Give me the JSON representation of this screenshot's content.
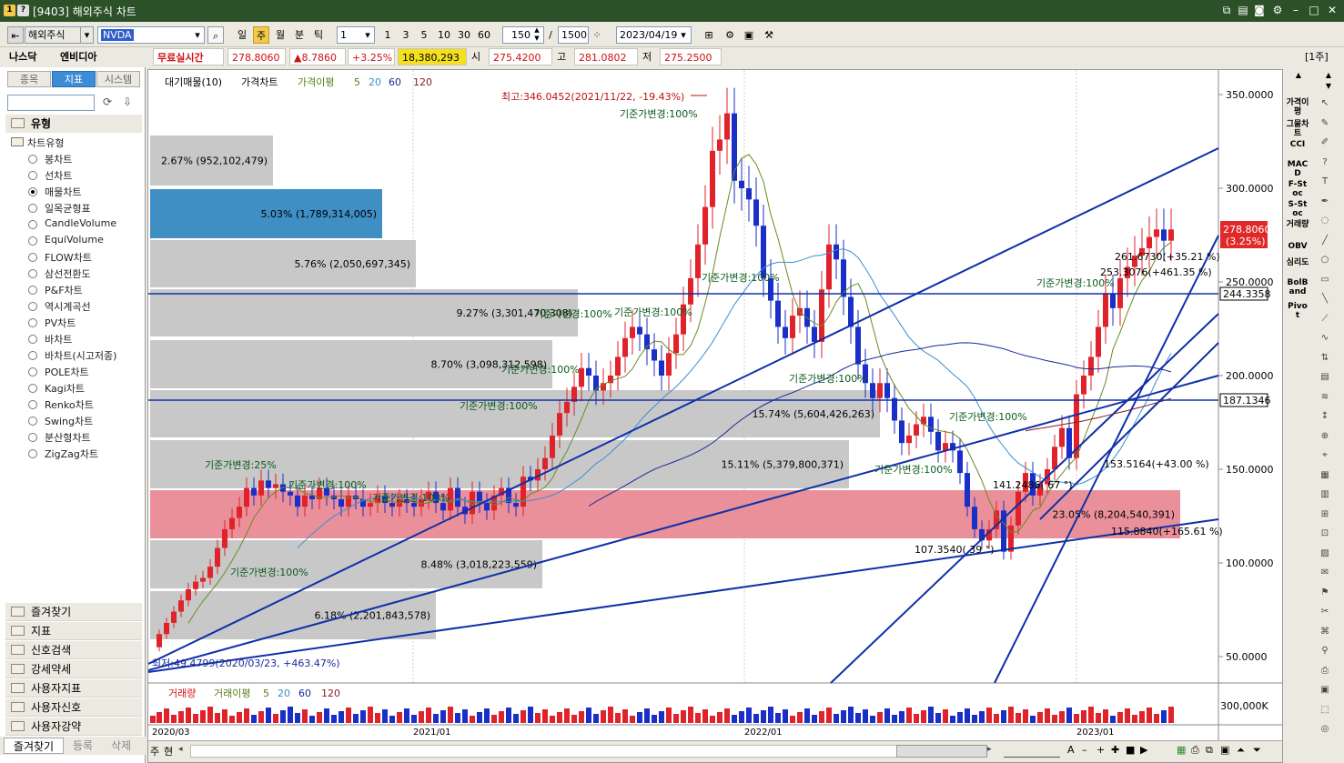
{
  "window": {
    "title": "[9403] 해외주식 차트",
    "icons": [
      "1",
      "?"
    ]
  },
  "toolbar": {
    "market": "해외주식",
    "symbol": "NVDA",
    "periods": [
      "일",
      "주",
      "월",
      "분",
      "틱"
    ],
    "active_period": "주",
    "interval": "1",
    "quick": [
      "1",
      "3",
      "5",
      "10",
      "30",
      "60"
    ],
    "count": "150",
    "count_sep": "/",
    "max": "1500",
    "date": "2023/04/19"
  },
  "info": {
    "exchange": "나스닥",
    "name": "엔비디아",
    "realtime": "무료실시간",
    "price": "278.8060",
    "change": "▲8.7860",
    "pct": "+3.25%",
    "volume": "18,380,293",
    "open_lbl": "시",
    "open": "275.4200",
    "high_lbl": "고",
    "high": "281.0802",
    "low_lbl": "저",
    "low": "275.2500",
    "unit": "[1주]"
  },
  "left": {
    "tabs": [
      "종목",
      "지표",
      "시스템"
    ],
    "section": "유형",
    "tree_root": "차트유형",
    "chart_types": [
      "봉차트",
      "선차트",
      "매물차트",
      "일목균형표",
      "CandleVolume",
      "EquiVolume",
      "FLOW차트",
      "삼선전환도",
      "P&F차트",
      "역시계곡선",
      "PV차트",
      "바차트",
      "바차트(시고저종)",
      "POLE차트",
      "Kagi차트",
      "Renko차트",
      "Swing차트",
      "분산형차트",
      "ZigZag차트"
    ],
    "selected": "매물차트",
    "folders": [
      "즐겨찾기",
      "지표",
      "신호검색",
      "강세약세",
      "사용자지표",
      "사용자신호",
      "사용자강약"
    ],
    "bottom_tabs": [
      "즐겨찾기",
      "등록",
      "삭제"
    ]
  },
  "price_legend": [
    "대기매물(10)",
    "가격차트",
    "가격이평",
    "5",
    "20",
    "60",
    "120"
  ],
  "volume_legend": [
    "거래량",
    "거래이평",
    "5",
    "20",
    "60",
    "120"
  ],
  "price_axis": [
    "350.0000",
    "300.0000",
    "250.0000",
    "200.0000",
    "150.0000",
    "100.0000",
    "50.0000"
  ],
  "volume_axis": "300,000K",
  "date_axis": [
    "2020/03",
    "2021/01",
    "2022/01",
    "2023/01"
  ],
  "last_price_badge": {
    "price": "278.8060",
    "pct": "(3.25%)"
  },
  "hline_badges": [
    "244.3358",
    "187.1346"
  ],
  "volume_profile": [
    {
      "label": "2.67% (952,102,479)"
    },
    {
      "label": "5.03% (1,789,314,005)"
    },
    {
      "label": "5.76% (2,050,697,345)"
    },
    {
      "label": "9.27% (3,301,470,308)"
    },
    {
      "label": "8.70% (3,098,312,598)"
    },
    {
      "label": "15.74% (5,604,426,263)"
    },
    {
      "label": "15.11% (5,379,800,371)"
    },
    {
      "label": "23.05% (8,204,540,391)"
    },
    {
      "label": "8.48% (3,018,223,559)"
    },
    {
      "label": "6.18% (2,201,843,578)"
    }
  ],
  "annotations": {
    "high": "최고:346.0452(2021/11/22, -19.43%)",
    "low": "최저:49.4799(2020/03/23, +463.47%)",
    "base_changes": [
      "기준가변경:100%",
      "기준가변경:100%",
      "기준가변경:100%",
      "기준가변경:100%",
      "기준가변경:100%",
      "기준가변경:25%",
      "기준가변경:100%",
      "기준가변경:100%",
      "기준가변경:100%",
      "기준가변경:100%",
      "기준가변경:100%",
      "기준가변경:100%",
      "기준가변경:100%",
      "기준가변경:100%"
    ],
    "trend_labels": [
      "261.6730(+35.21 %)",
      "253.3076(+461.35 %)",
      "141.2486( 67 °)",
      "153.5164(+43.00 %)",
      "115.8840(+165.61 %)",
      "107.3540( 39 °)"
    ]
  },
  "right_bar": [
    "가격이평",
    "그물차트",
    "CCI",
    "MACD",
    "F-Stoc",
    "S-Stoc",
    "거래량",
    "OBV",
    "심리도",
    "BolBand",
    "Pivot"
  ],
  "bottom_nav": [
    "주",
    "현"
  ],
  "colors": {
    "up": "#e0222a",
    "down": "#1a2ec8",
    "trend": "#1030a8",
    "titlebar": "#2c5129"
  }
}
